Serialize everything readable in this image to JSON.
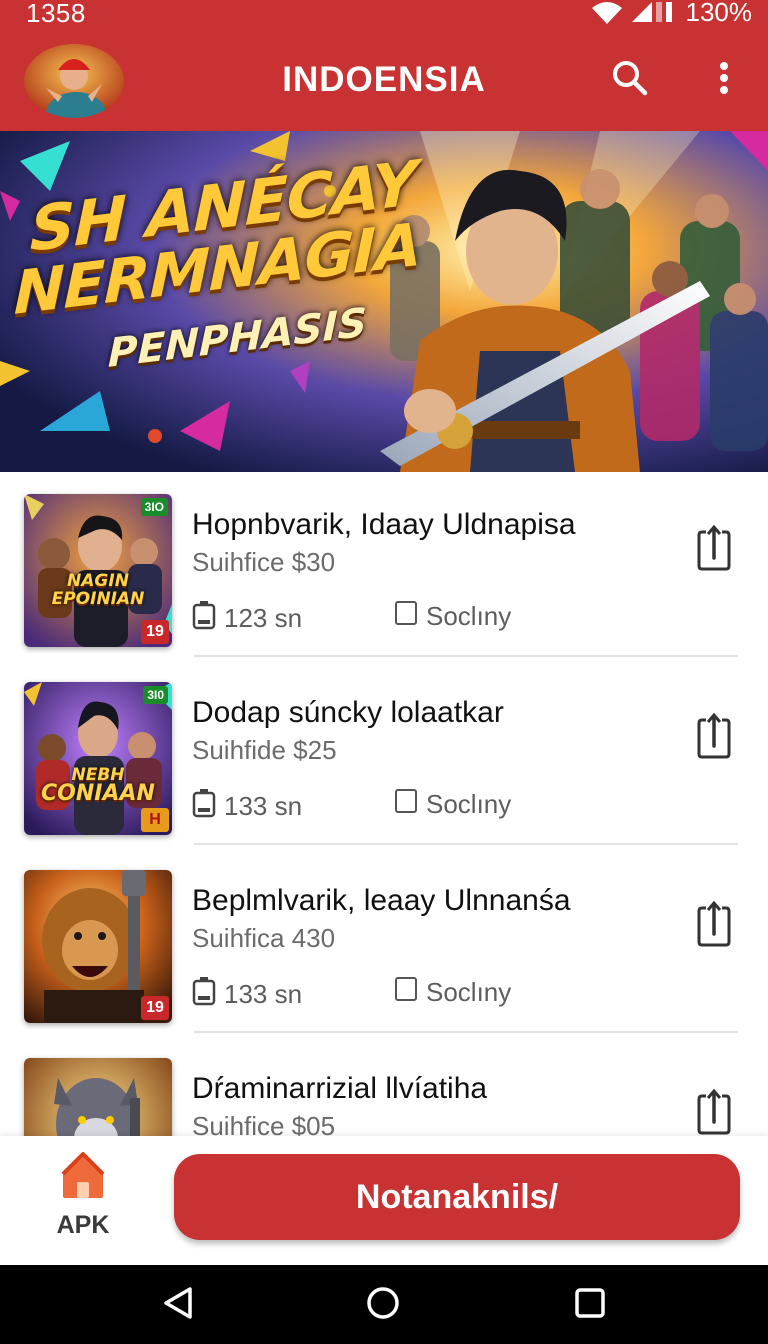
{
  "status_bar": {
    "time": "1358",
    "battery": "130%"
  },
  "app_bar": {
    "title": "INDOENSIA",
    "icons": [
      "avatar-logo",
      "search-icon",
      "more-vertical-icon"
    ]
  },
  "banner": {
    "line1": "SH ANÉCAY",
    "line2": "NERMNAGIA",
    "line3": "PENPHASIS"
  },
  "list": {
    "items": [
      {
        "title": "Hopnbvarik, Idaay Uldnapisa",
        "subtitle": "Suihfice $30",
        "size": "123 sn",
        "check_label": "Soclıny",
        "thumb_caption_1": "NAGIN",
        "thumb_caption_2": "EPOINIAN",
        "thumb_badge": "19",
        "thumb_tag": "3IO"
      },
      {
        "title": "Dodap súncky lolaatkar",
        "subtitle": "Suihfide $25",
        "size": "133 sn",
        "check_label": "Soclıny",
        "thumb_caption_1": "NEBH",
        "thumb_caption_2": "CONIAAN",
        "thumb_badge": "H",
        "thumb_tag": "3I0"
      },
      {
        "title": "Beplmlvarik, leaay Ulnnanśa",
        "subtitle": "Suihfica 430",
        "size": "133 sn",
        "check_label": "Soclıny",
        "thumb_badge": "19"
      },
      {
        "title": "Dŕaminarrizial llvíatiha",
        "subtitle": "Suihfice $05"
      }
    ]
  },
  "bottom_bar": {
    "apk_label": "APK",
    "cta_label": "Notanaknils/"
  },
  "colors": {
    "primary": "#c83232",
    "title_text": "#111111",
    "secondary_text": "#6b6b6b"
  }
}
